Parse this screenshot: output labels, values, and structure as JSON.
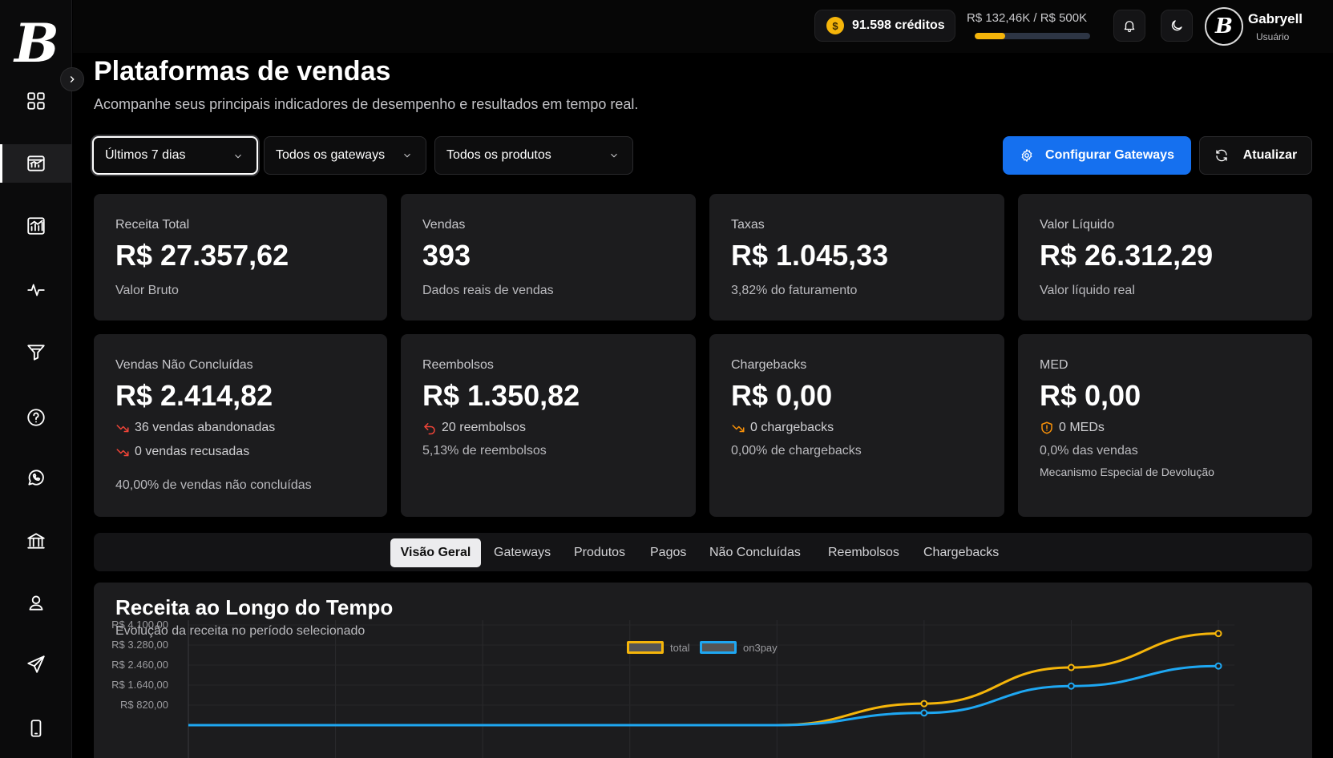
{
  "app": {
    "logo_letter": "B"
  },
  "sidebar": {
    "items": [
      {
        "name": "dashboard-icon",
        "active": false
      },
      {
        "name": "sales-platforms-icon",
        "active": true
      },
      {
        "name": "analytics-icon",
        "active": false
      },
      {
        "name": "activity-icon",
        "active": false
      },
      {
        "name": "funnel-icon",
        "active": false
      },
      {
        "name": "help-icon",
        "active": false
      },
      {
        "name": "whatsapp-icon",
        "active": false
      },
      {
        "name": "bank-icon",
        "active": false
      },
      {
        "name": "user-icon",
        "active": false
      },
      {
        "name": "send-icon",
        "active": false
      },
      {
        "name": "mobile-icon",
        "active": false
      }
    ]
  },
  "topbar": {
    "credits": "91.598 créditos",
    "coin_symbol": "$",
    "goal_text": "R$ 132,46K / R$ 500K",
    "goal_progress": 0.265,
    "user_name": "Gabryell",
    "user_role": "Usuário",
    "avatar_letter": "B"
  },
  "header": {
    "title": "Plataformas de vendas",
    "subtitle": "Acompanhe seus principais indicadores de desempenho e resultados em tempo real."
  },
  "filters": {
    "period": "Últimos 7 dias",
    "gateway": "Todos os gateways",
    "product": "Todos os produtos"
  },
  "actions": {
    "configure": "Configurar Gateways",
    "refresh": "Atualizar"
  },
  "cards": {
    "revenue": {
      "label": "Receita Total",
      "value": "R$ 27.357,62",
      "sub": "Valor Bruto"
    },
    "sales": {
      "label": "Vendas",
      "value": "393",
      "sub": "Dados reais de vendas"
    },
    "fees": {
      "label": "Taxas",
      "value": "R$ 1.045,33",
      "sub": "3,82% do faturamento"
    },
    "net": {
      "label": "Valor Líquido",
      "value": "R$ 26.312,29",
      "sub": "Valor líquido real"
    },
    "incomplete": {
      "label": "Vendas Não Concluídas",
      "value": "R$ 2.414,82",
      "abandoned": "36 vendas abandonadas",
      "refused": "0 vendas recusadas",
      "sub": "40,00% de vendas não concluídas"
    },
    "refunds": {
      "label": "Reembolsos",
      "value": "R$ 1.350,82",
      "count": "20 reembolsos",
      "sub": "5,13% de reembolsos"
    },
    "chargebacks": {
      "label": "Chargebacks",
      "value": "R$ 0,00",
      "count": "0 chargebacks",
      "sub": "0,00% de chargebacks"
    },
    "med": {
      "label": "MED",
      "value": "R$ 0,00",
      "count": "0 MEDs",
      "sub": "0,0% das vendas",
      "note": "Mecanismo Especial de Devolução"
    }
  },
  "tabs": [
    "Visão Geral",
    "Gateways",
    "Produtos",
    "Pagos",
    "Não Concluídas",
    "Reembolsos",
    "Chargebacks"
  ],
  "chart_data": {
    "type": "line",
    "title": "Receita ao Longo do Tempo",
    "subtitle": "Evolução da receita no período selecionado",
    "y_ticks": [
      "R$ 4.100,00",
      "R$ 3.280,00",
      "R$ 2.460,00",
      "R$ 1.640,00",
      "R$ 820,00"
    ],
    "ylim": [
      0,
      4100
    ],
    "grid": true,
    "legend_position": "top-center",
    "series": [
      {
        "name": "total",
        "color": "#f5b50a",
        "values": [
          0,
          0,
          0,
          0,
          0,
          880,
          2360,
          3750
        ]
      },
      {
        "name": "on3pay",
        "color": "#1ea7f2",
        "values": [
          0,
          0,
          0,
          0,
          0,
          500,
          1600,
          2420
        ]
      }
    ]
  }
}
